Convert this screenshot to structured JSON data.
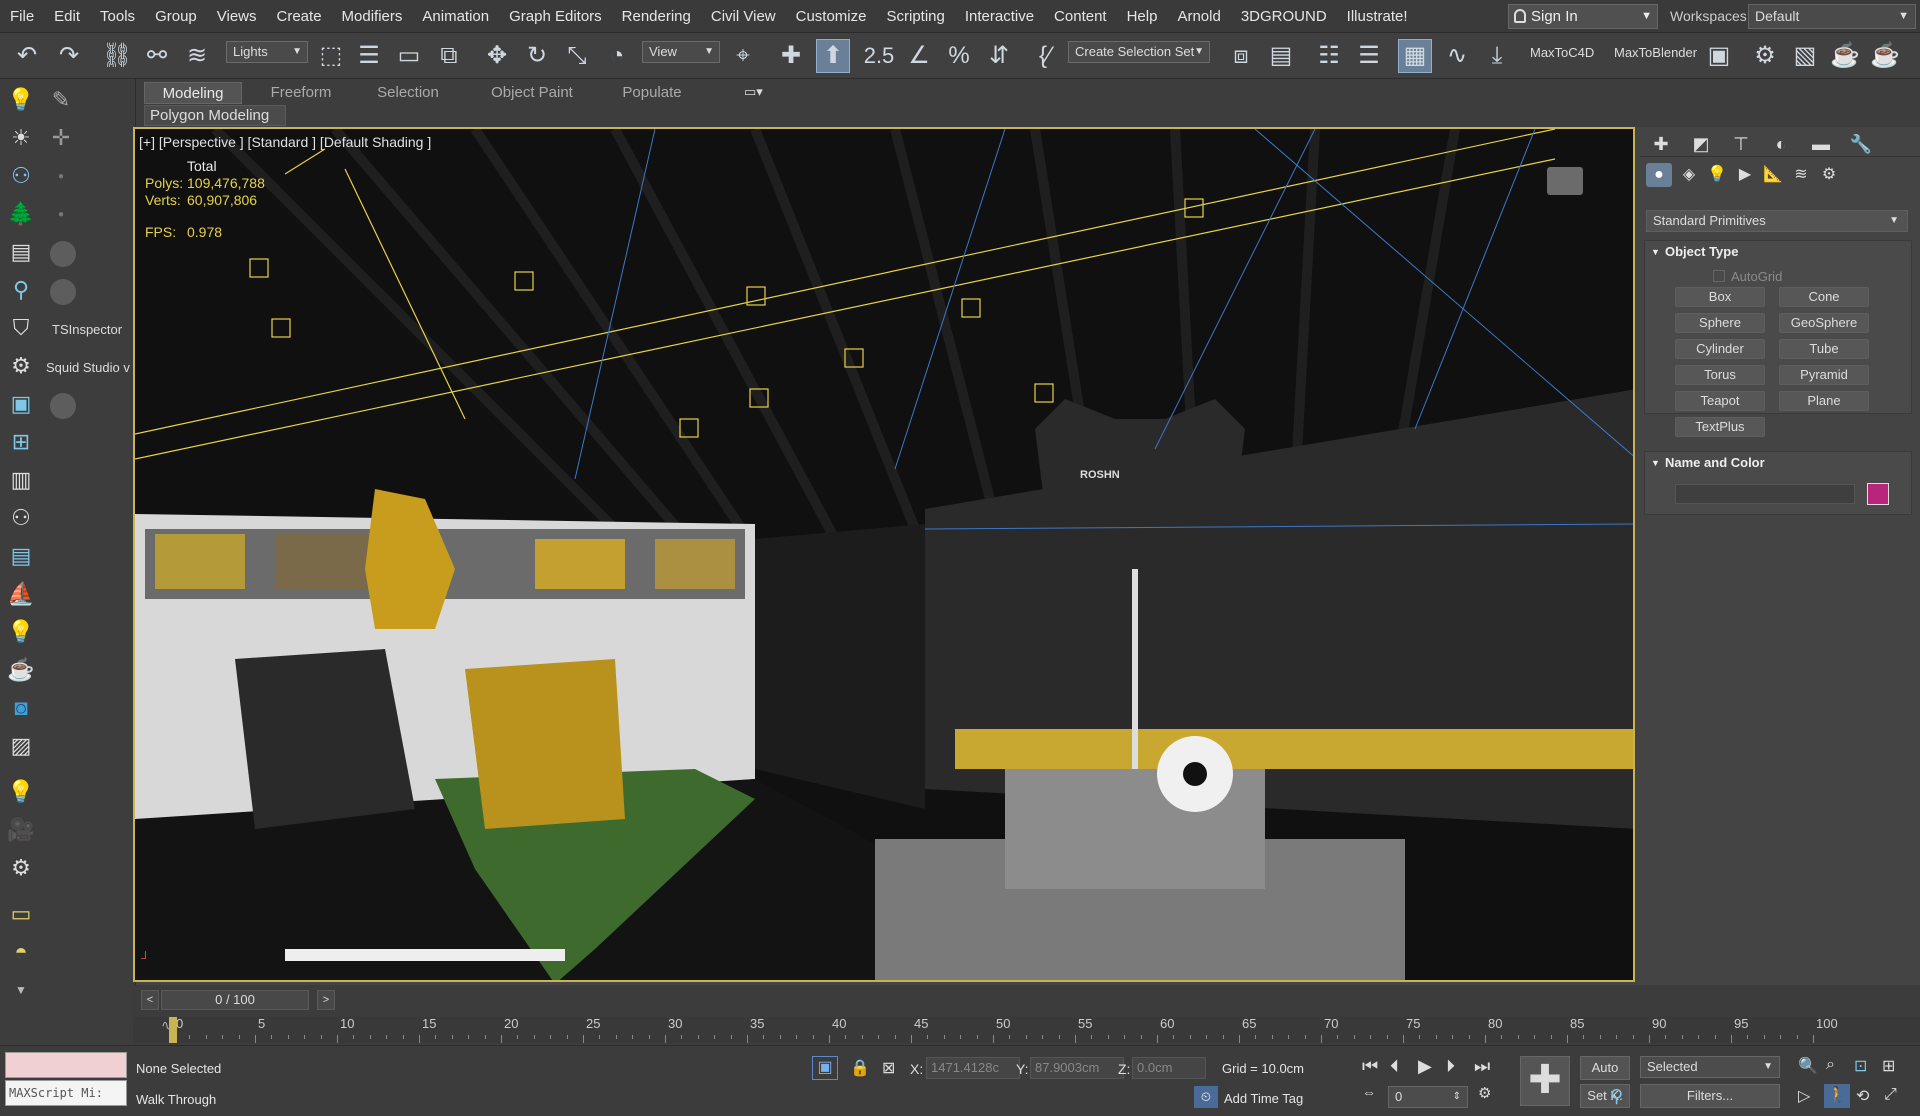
{
  "menu": [
    "File",
    "Edit",
    "Tools",
    "Group",
    "Views",
    "Create",
    "Modifiers",
    "Animation",
    "Graph Editors",
    "Rendering",
    "Civil View",
    "Customize",
    "Scripting",
    "Interactive",
    "Content",
    "Help",
    "Arnold",
    "3DGROUND",
    "Illustrate!"
  ],
  "account": {
    "sign_in": "Sign In",
    "workspaces_label": "Workspaces:",
    "workspace": "Default"
  },
  "toolbar": {
    "filter": "Lights",
    "ref_coord": "View",
    "snap_value": "2.5",
    "selection_set": "Create Selection Set",
    "plugin1": "MaxToC4D",
    "plugin2": "MaxToBlender"
  },
  "ribbon": {
    "tabs": [
      "Modeling",
      "Freeform",
      "Selection",
      "Object Paint",
      "Populate"
    ],
    "panel": "Polygon Modeling"
  },
  "left_tools": {
    "ts_inspector": "TSInspector",
    "squid": "Squid Studio v"
  },
  "viewport": {
    "label": "[+] [Perspective ] [Standard ] [Default Shading ]",
    "stats_header": "Total",
    "polys_label": "Polys:",
    "polys": "109,476,788",
    "verts_label": "Verts:",
    "verts": "60,907,806",
    "fps_label": "FPS:",
    "fps": "0.978",
    "jersey_text": "ROSHN"
  },
  "command_panel": {
    "category": "Standard Primitives",
    "object_type_title": "Object Type",
    "autogrid": "AutoGrid",
    "buttons": [
      "Box",
      "Cone",
      "Sphere",
      "GeoSphere",
      "Cylinder",
      "Tube",
      "Torus",
      "Pyramid",
      "Teapot",
      "Plane",
      "TextPlus"
    ],
    "name_color_title": "Name and Color",
    "object_color": "#b8257a"
  },
  "timeline": {
    "frame": "0 / 100",
    "ticks": [
      "0",
      "5",
      "10",
      "15",
      "20",
      "25",
      "30",
      "35",
      "40",
      "45",
      "50",
      "55",
      "60",
      "65",
      "70",
      "75",
      "80",
      "85",
      "90",
      "95",
      "100"
    ]
  },
  "status": {
    "maxscript": "MAXScript Mi:",
    "selection": "None Selected",
    "mode": "Walk Through",
    "x": "1471.4128c",
    "y": "87.9003cm",
    "z": "0.0cm",
    "grid": "Grid = 10.0cm",
    "add_time_tag": "Add Time Tag",
    "auto": "Auto",
    "setk": "Set K.",
    "selected": "Selected",
    "filters": "Filters...",
    "frame_field": "0"
  }
}
